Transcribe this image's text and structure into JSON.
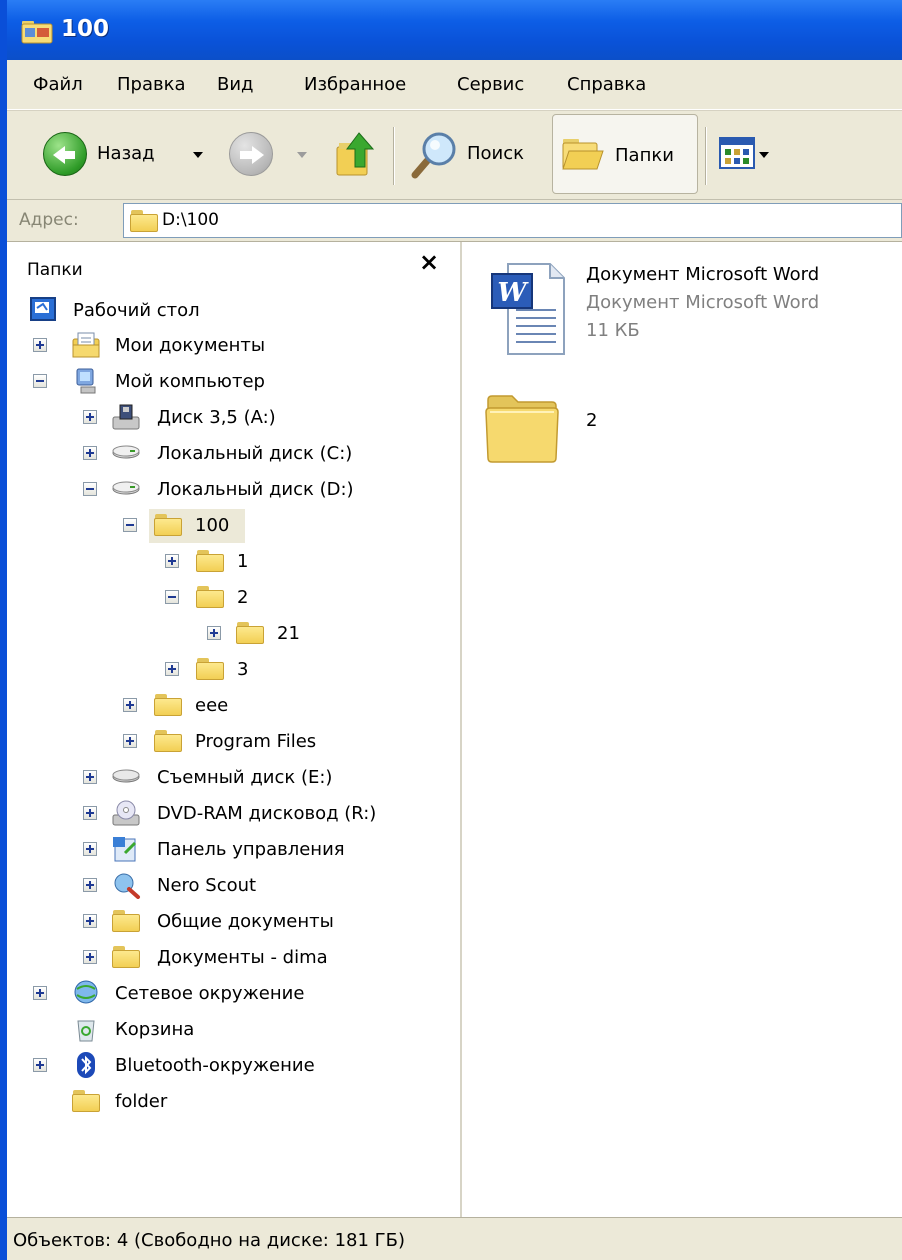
{
  "window": {
    "title": "100"
  },
  "menu": [
    "Файл",
    "Правка",
    "Вид",
    "Избранное",
    "Сервис",
    "Справка"
  ],
  "toolbar": {
    "back_label": "Назад",
    "search_label": "Поиск",
    "folders_label": "Папки"
  },
  "address": {
    "label": "Адрес:",
    "value": "D:\\100"
  },
  "folders_pane": {
    "title": "Папки",
    "close": "×",
    "tree": [
      {
        "label": "Рабочий стол",
        "icon": "desktop-icon",
        "toggle": "none"
      },
      {
        "label": "Мои документы",
        "icon": "my-documents-icon",
        "toggle": "plus"
      },
      {
        "label": "Мой компьютер",
        "icon": "my-computer-icon",
        "toggle": "minus"
      },
      {
        "label": "Диск 3,5 (A:)",
        "icon": "floppy-drive-icon",
        "toggle": "plus"
      },
      {
        "label": "Локальный диск (C:)",
        "icon": "hard-drive-icon",
        "toggle": "plus"
      },
      {
        "label": "Локальный диск (D:)",
        "icon": "hard-drive-icon",
        "toggle": "minus"
      },
      {
        "label": "100",
        "icon": "folder-open-icon",
        "toggle": "minus",
        "selected": true
      },
      {
        "label": "1",
        "icon": "folder-icon",
        "toggle": "plus"
      },
      {
        "label": "2",
        "icon": "folder-icon",
        "toggle": "minus"
      },
      {
        "label": "21",
        "icon": "folder-icon",
        "toggle": "plus"
      },
      {
        "label": "3",
        "icon": "folder-icon",
        "toggle": "plus"
      },
      {
        "label": "eee",
        "icon": "folder-icon",
        "toggle": "plus"
      },
      {
        "label": "Program Files",
        "icon": "folder-icon",
        "toggle": "plus"
      },
      {
        "label": "Съемный диск (E:)",
        "icon": "removable-drive-icon",
        "toggle": "plus"
      },
      {
        "label": "DVD-RAM дисковод (R:)",
        "icon": "dvd-drive-icon",
        "toggle": "plus"
      },
      {
        "label": "Панель управления",
        "icon": "control-panel-icon",
        "toggle": "plus"
      },
      {
        "label": "Nero Scout",
        "icon": "nero-scout-icon",
        "toggle": "plus"
      },
      {
        "label": "Общие документы",
        "icon": "folder-icon",
        "toggle": "plus"
      },
      {
        "label": "Документы - dima",
        "icon": "folder-icon",
        "toggle": "plus"
      },
      {
        "label": "Сетевое окружение",
        "icon": "network-icon",
        "toggle": "plus"
      },
      {
        "label": "Корзина",
        "icon": "recycle-bin-icon",
        "toggle": "none"
      },
      {
        "label": "Bluetooth-окружение",
        "icon": "bluetooth-icon",
        "toggle": "plus"
      },
      {
        "label": "folder",
        "icon": "folder-icon",
        "toggle": "none"
      }
    ]
  },
  "files": [
    {
      "name": "Документ Microsoft Word",
      "type": "Документ Microsoft Word",
      "size": "11 КБ",
      "icon": "word-document-icon"
    },
    {
      "name": "2",
      "icon": "folder-icon"
    }
  ],
  "status": {
    "text": "Объектов: 4 (Свободно на диске: 181 ГБ)"
  },
  "colors": {
    "titlebar": "#0a52d8",
    "chrome": "#ece9d8",
    "folder": "#f2cf54"
  }
}
